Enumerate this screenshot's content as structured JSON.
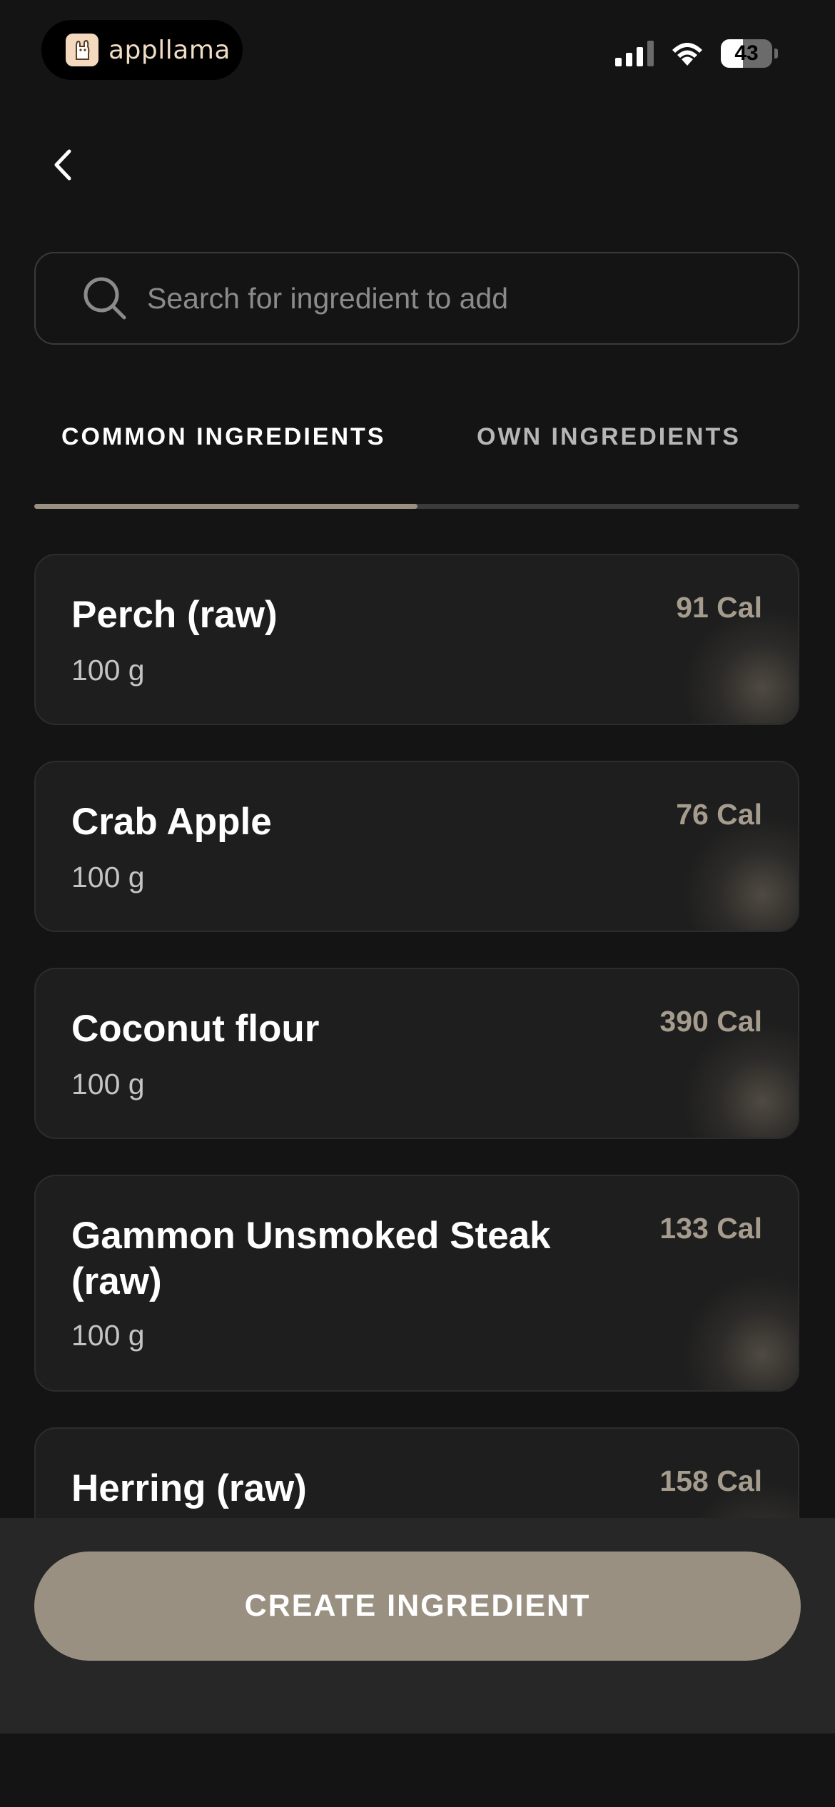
{
  "status_bar": {
    "app_name": "appllama",
    "battery_percent": 43,
    "battery_label": "43",
    "icons": [
      "app-logo-icon",
      "signal-icon",
      "wifi-icon",
      "battery-icon"
    ]
  },
  "nav": {
    "back_icon": "chevron-left-icon"
  },
  "search": {
    "placeholder": "Search for ingredient to add",
    "value": "",
    "icon": "search-icon"
  },
  "tabs": [
    {
      "label": "COMMON INGREDIENTS",
      "active": true
    },
    {
      "label": "OWN INGREDIENTS",
      "active": false
    }
  ],
  "ingredients": [
    {
      "name": "Perch (raw)",
      "quantity": "100 g",
      "calories": "91 Cal"
    },
    {
      "name": "Crab Apple",
      "quantity": "100 g",
      "calories": "76 Cal"
    },
    {
      "name": "Coconut flour",
      "quantity": "100 g",
      "calories": "390 Cal"
    },
    {
      "name": "Gammon Unsmoked Steak (raw)",
      "quantity": "100 g",
      "calories": "133 Cal"
    },
    {
      "name": "Herring (raw)",
      "quantity": "",
      "calories": "158 Cal"
    }
  ],
  "actions": {
    "create_label": "CREATE INGREDIENT"
  },
  "colors": {
    "background": "#141414",
    "card": "#1e1e1e",
    "accent": "#9a9081",
    "calorie_text": "#a59c8e"
  }
}
